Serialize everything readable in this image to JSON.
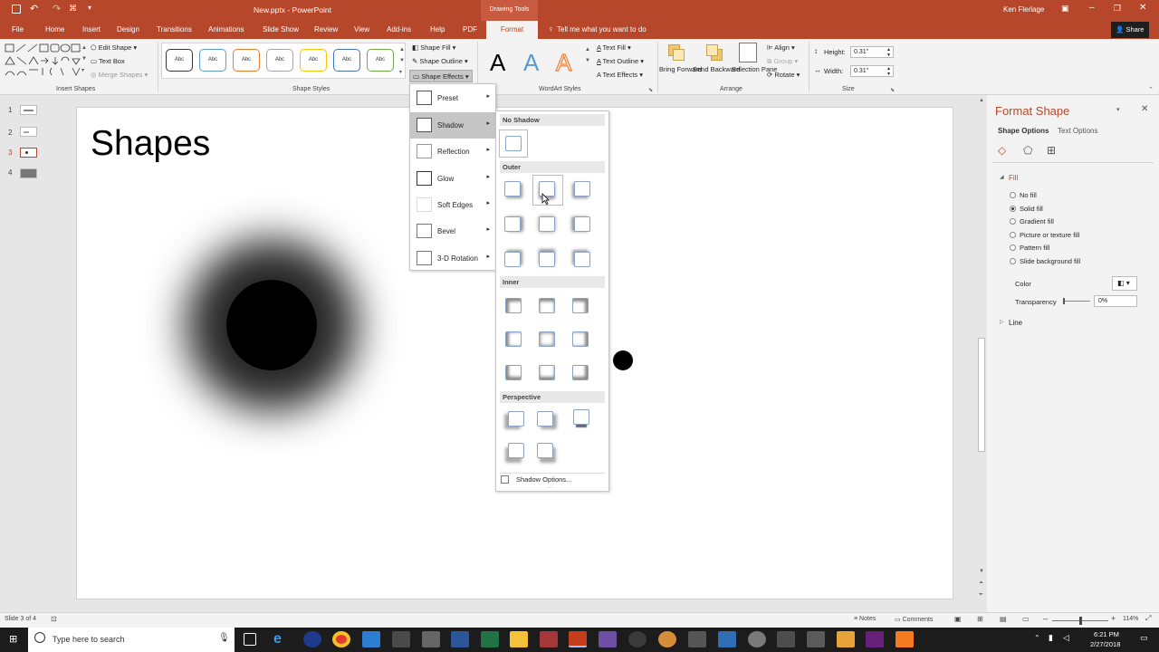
{
  "app": {
    "file_title": "New.pptx",
    "separator": " - ",
    "app_name": "PowerPoint",
    "drawing_tools": "Drawing Tools",
    "user": "Ken Flerlage"
  },
  "tabs": [
    "File",
    "Home",
    "Insert",
    "Design",
    "Transitions",
    "Animations",
    "Slide Show",
    "Review",
    "View",
    "Add-ins",
    "Help",
    "PDF",
    "Format"
  ],
  "tell_me": "Tell me what you want to do",
  "share": "Share",
  "ribbon": {
    "insert_shapes": {
      "edit_shape": "Edit Shape",
      "text_box": "Text Box",
      "merge_shapes": "Merge Shapes",
      "label": "Insert Shapes"
    },
    "shape_styles": {
      "sample": "Abc",
      "label": "Shape Styles",
      "shape_fill": "Shape Fill",
      "shape_outline": "Shape Outline",
      "shape_effects": "Shape Effects"
    },
    "wordart": {
      "letter": "A",
      "text_fill": "Text Fill",
      "text_outline": "Text Outline",
      "text_effects": "Text Effects",
      "label": "WordArt Styles"
    },
    "arrange": {
      "bring_forward": "Bring Forward",
      "send_backward": "Send Backward",
      "selection_pane": "Selection Pane",
      "align": "Align",
      "group": "Group",
      "rotate": "Rotate",
      "label": "Arrange"
    },
    "size": {
      "height_label": "Height:",
      "height_value": "0.31\"",
      "width_label": "Width:",
      "width_value": "0.31\"",
      "label": "Size"
    }
  },
  "slides": [
    "1",
    "2",
    "3",
    "4"
  ],
  "slide_title": "Shapes",
  "effects_menu": [
    "Preset",
    "Shadow",
    "Reflection",
    "Glow",
    "Soft Edges",
    "Bevel",
    "3-D Rotation"
  ],
  "shadow_gallery": {
    "no_shadow": "No Shadow",
    "outer": "Outer",
    "inner": "Inner",
    "perspective": "Perspective",
    "options": "Shadow Options..."
  },
  "format_pane": {
    "title": "Format Shape",
    "tab_shape": "Shape Options",
    "tab_text": "Text Options",
    "fill": "Fill",
    "fill_options": [
      "No fill",
      "Solid fill",
      "Gradient fill",
      "Picture or texture fill",
      "Pattern fill",
      "Slide background fill"
    ],
    "color": "Color",
    "transparency": "Transparency",
    "transparency_value": "0%",
    "line": "Line"
  },
  "status": {
    "slide": "Slide 3 of 4",
    "notes": "Notes",
    "comments": "Comments",
    "zoom": "114%"
  },
  "taskbar": {
    "search": "Type here to search",
    "time": "6:21 PM",
    "date": "2/27/2018"
  },
  "colors": {
    "accent": "#b7472a",
    "shadow_accent": "#8aa3c8"
  }
}
